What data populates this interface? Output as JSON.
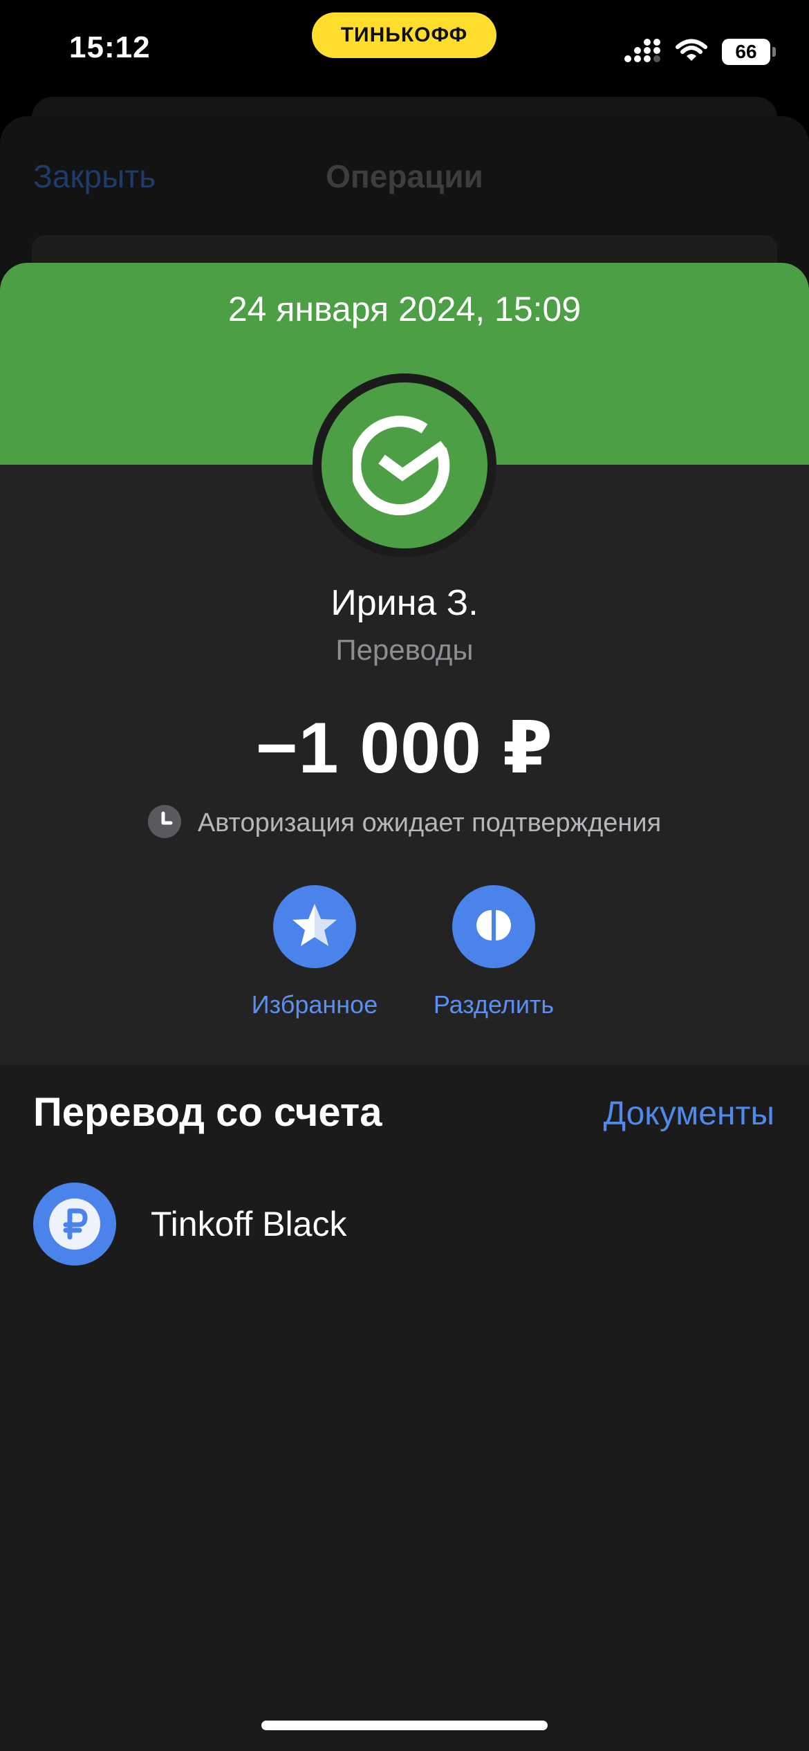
{
  "status_bar": {
    "time": "15:12",
    "brand": "ТИНЬКОФФ",
    "battery": "66",
    "icons": [
      "signal-icon",
      "wifi-icon",
      "battery-icon"
    ]
  },
  "background_screen": {
    "close_label": "Закрыть",
    "title": "Операции"
  },
  "operation": {
    "date": "24 января 2024, 15:09",
    "merchant_logo": "sber-logo",
    "recipient": "Ирина З.",
    "category": "Переводы",
    "amount": "−1 000 ₽",
    "status_icon": "clock-icon",
    "status_text": "Авторизация ожидает подтверждения"
  },
  "actions": [
    {
      "icon": "star-icon",
      "label": "Избранное"
    },
    {
      "icon": "split-icon",
      "label": "Разделить"
    }
  ],
  "source_section": {
    "title": "Перевод со счета",
    "documents_label": "Документы",
    "account": {
      "icon": "ruble-icon",
      "name": "Tinkoff Black"
    }
  },
  "colors": {
    "header_green": "#4c9f45",
    "accent_blue": "#4a83ea",
    "link_blue": "#4f89e9",
    "brand_yellow": "#ffdd2d"
  }
}
